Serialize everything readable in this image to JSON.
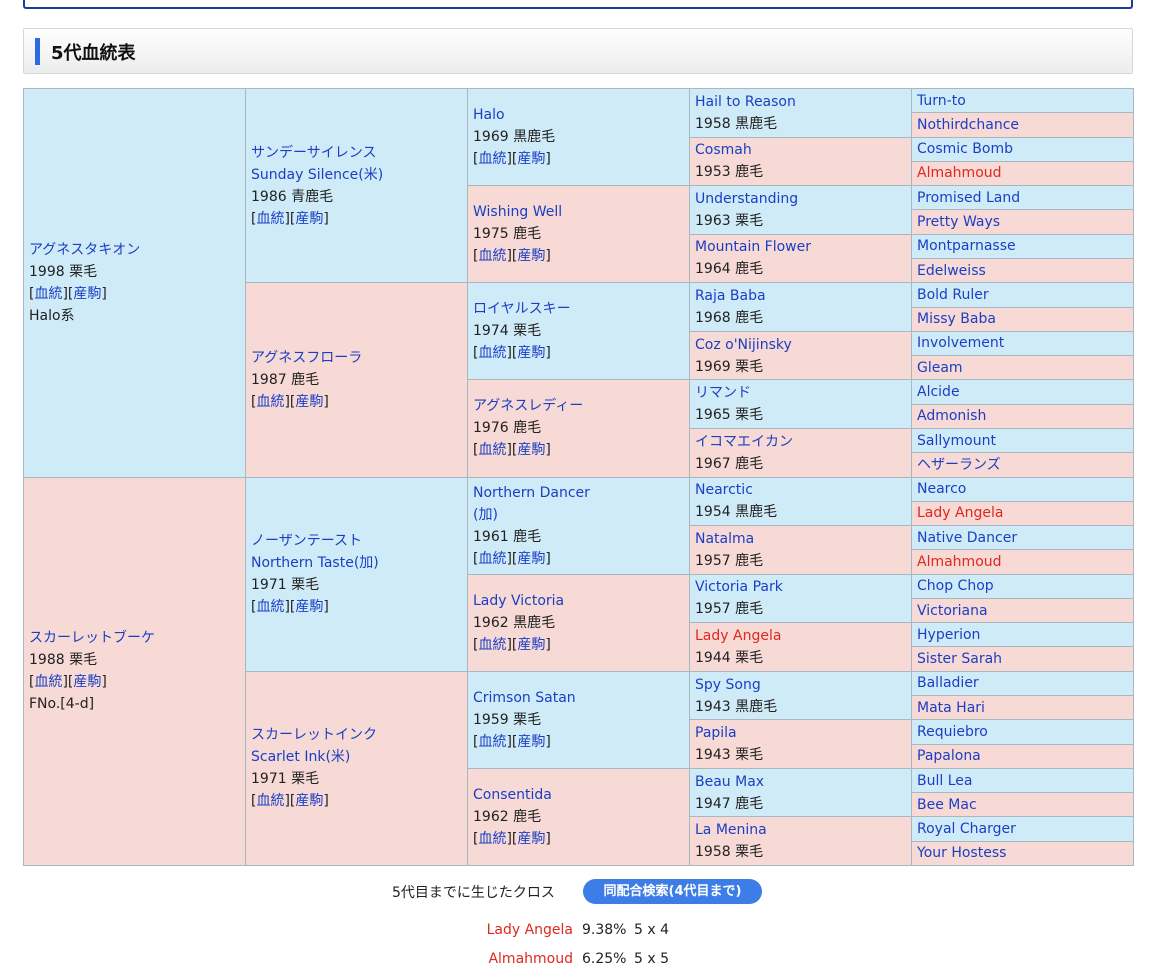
{
  "header": {
    "title": "5代血統表"
  },
  "labels": {
    "pedigree_link": "血統",
    "offspring_link": "産駒"
  },
  "gen1": [
    {
      "name": "アグネスタキオン",
      "info": "1998 栗毛",
      "line": "Halo系",
      "side": "sire"
    },
    {
      "name": "スカーレットブーケ",
      "info": "1988 栗毛",
      "line": "FNo.[4-d]",
      "side": "dam"
    }
  ],
  "gen2": [
    {
      "name": "サンデーサイレンス",
      "name2": "Sunday Silence(米)",
      "info": "1986 青鹿毛",
      "side": "sire"
    },
    {
      "name": "アグネスフローラ",
      "info": "1987 鹿毛",
      "side": "dam"
    },
    {
      "name": "ノーザンテースト",
      "name2": "Northern Taste(加)",
      "info": "1971 栗毛",
      "side": "sire"
    },
    {
      "name": "スカーレットインク",
      "name2": "Scarlet Ink(米)",
      "info": "1971 栗毛",
      "side": "dam"
    }
  ],
  "gen3": [
    {
      "name": "Halo",
      "info": "1969 黒鹿毛",
      "side": "sire"
    },
    {
      "name": "Wishing Well",
      "info": "1975 鹿毛",
      "side": "dam"
    },
    {
      "name": "ロイヤルスキー",
      "info": "1974 栗毛",
      "side": "sire"
    },
    {
      "name": "アグネスレディー",
      "info": "1976 鹿毛",
      "side": "dam"
    },
    {
      "name": "Northern Dancer",
      "name2": "(加)",
      "info": "1961 鹿毛",
      "side": "sire"
    },
    {
      "name": "Lady Victoria",
      "info": "1962 黒鹿毛",
      "side": "dam"
    },
    {
      "name": "Crimson Satan",
      "info": "1959 栗毛",
      "side": "sire"
    },
    {
      "name": "Consentida",
      "info": "1962 鹿毛",
      "side": "dam"
    }
  ],
  "gen4": [
    {
      "name": "Hail to Reason",
      "info": "1958 黒鹿毛",
      "side": "sire",
      "highlight": false
    },
    {
      "name": "Cosmah",
      "info": "1953 鹿毛",
      "side": "dam",
      "highlight": false
    },
    {
      "name": "Understanding",
      "info": "1963 栗毛",
      "side": "sire",
      "highlight": false
    },
    {
      "name": "Mountain Flower",
      "info": "1964 鹿毛",
      "side": "dam",
      "highlight": false
    },
    {
      "name": "Raja Baba",
      "info": "1968 鹿毛",
      "side": "sire",
      "highlight": false
    },
    {
      "name": "Coz o'Nijinsky",
      "info": "1969 栗毛",
      "side": "dam",
      "highlight": false
    },
    {
      "name": "リマンド",
      "info": "1965 栗毛",
      "side": "sire",
      "highlight": false
    },
    {
      "name": "イコマエイカン",
      "info": "1967 鹿毛",
      "side": "dam",
      "highlight": false
    },
    {
      "name": "Nearctic",
      "info": "1954 黒鹿毛",
      "side": "sire",
      "highlight": false
    },
    {
      "name": "Natalma",
      "info": "1957 鹿毛",
      "side": "dam",
      "highlight": false
    },
    {
      "name": "Victoria Park",
      "info": "1957 鹿毛",
      "side": "sire",
      "highlight": false
    },
    {
      "name": "Lady Angela",
      "info": "1944 栗毛",
      "side": "dam",
      "highlight": true
    },
    {
      "name": "Spy Song",
      "info": "1943 黒鹿毛",
      "side": "sire",
      "highlight": false
    },
    {
      "name": "Papila",
      "info": "1943 栗毛",
      "side": "dam",
      "highlight": false
    },
    {
      "name": "Beau Max",
      "info": "1947 鹿毛",
      "side": "sire",
      "highlight": false
    },
    {
      "name": "La Menina",
      "info": "1958 栗毛",
      "side": "dam",
      "highlight": false
    }
  ],
  "gen5": [
    {
      "name": "Turn-to",
      "highlight": false
    },
    {
      "name": "Nothirdchance",
      "highlight": false
    },
    {
      "name": "Cosmic Bomb",
      "highlight": false
    },
    {
      "name": "Almahmoud",
      "highlight": true
    },
    {
      "name": "Promised Land",
      "highlight": false
    },
    {
      "name": "Pretty Ways",
      "highlight": false
    },
    {
      "name": "Montparnasse",
      "highlight": false
    },
    {
      "name": "Edelweiss",
      "highlight": false
    },
    {
      "name": "Bold Ruler",
      "highlight": false
    },
    {
      "name": "Missy Baba",
      "highlight": false
    },
    {
      "name": "Involvement",
      "highlight": false
    },
    {
      "name": "Gleam",
      "highlight": false
    },
    {
      "name": "Alcide",
      "highlight": false
    },
    {
      "name": "Admonish",
      "highlight": false
    },
    {
      "name": "Sallymount",
      "highlight": false
    },
    {
      "name": "ヘザーランズ",
      "highlight": false
    },
    {
      "name": "Nearco",
      "highlight": false
    },
    {
      "name": "Lady Angela",
      "highlight": true
    },
    {
      "name": "Native Dancer",
      "highlight": false
    },
    {
      "name": "Almahmoud",
      "highlight": true
    },
    {
      "name": "Chop Chop",
      "highlight": false
    },
    {
      "name": "Victoriana",
      "highlight": false
    },
    {
      "name": "Hyperion",
      "highlight": false
    },
    {
      "name": "Sister Sarah",
      "highlight": false
    },
    {
      "name": "Balladier",
      "highlight": false
    },
    {
      "name": "Mata Hari",
      "highlight": false
    },
    {
      "name": "Requiebro",
      "highlight": false
    },
    {
      "name": "Papalona",
      "highlight": false
    },
    {
      "name": "Bull Lea",
      "highlight": false
    },
    {
      "name": "Bee Mac",
      "highlight": false
    },
    {
      "name": "Royal Charger",
      "highlight": false
    },
    {
      "name": "Your Hostess",
      "highlight": false
    }
  ],
  "cross": {
    "label": "5代目までに生じたクロス",
    "button": "同配合検索(4代目まで)",
    "rows": [
      {
        "name": "Lady Angela",
        "percent": "9.38%",
        "pattern": "5 x 4"
      },
      {
        "name": "Almahmoud",
        "percent": "6.25%",
        "pattern": "5 x 5"
      }
    ]
  }
}
